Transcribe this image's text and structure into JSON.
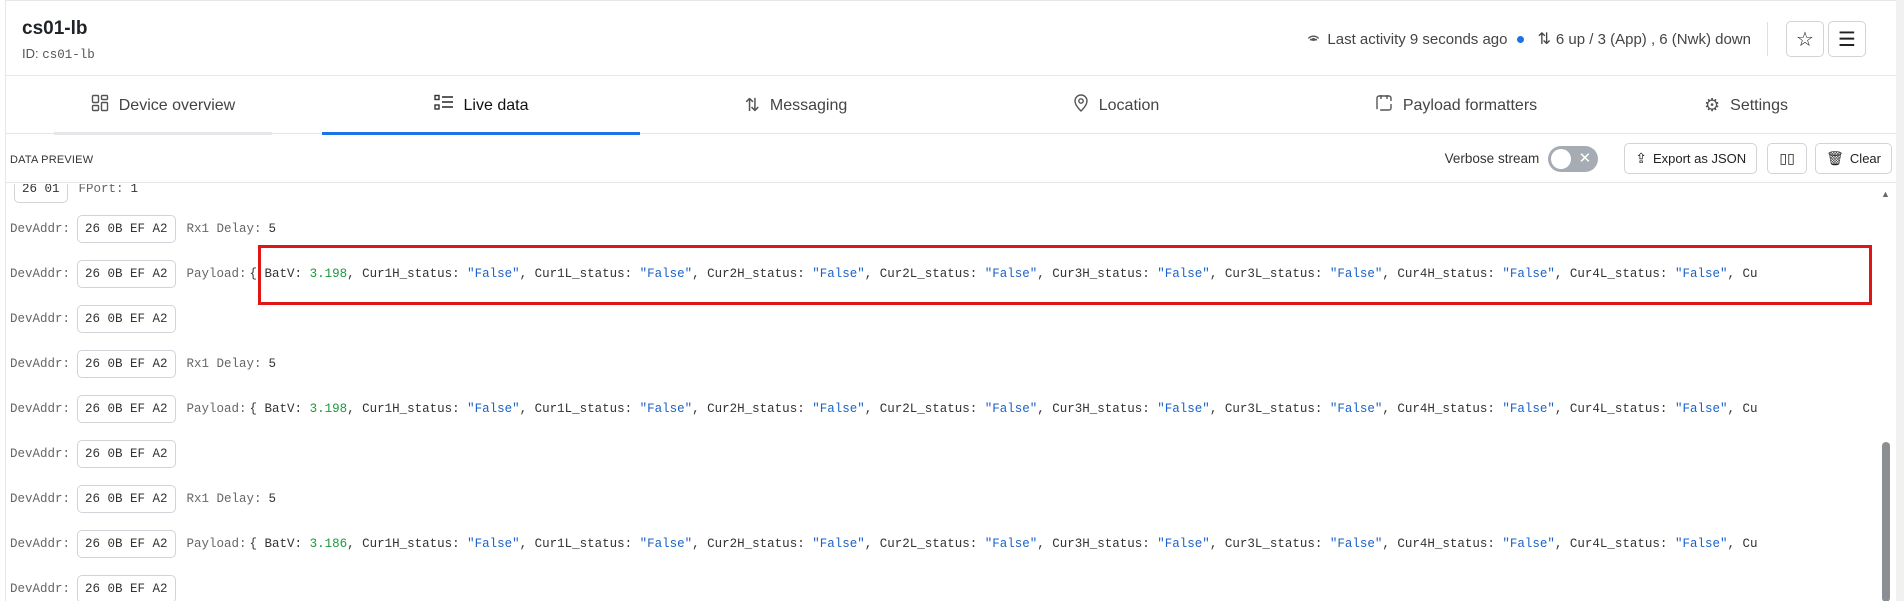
{
  "device": {
    "title": "cs01-lb",
    "id_label": "ID:",
    "id_value": "cs01-lb"
  },
  "header": {
    "last_activity": "Last activity 9 seconds ago",
    "updown": "6 up / 3 (App) , 6 (Nwk) down",
    "favorite_icon": "star-icon",
    "menu_icon": "hamburger-icon"
  },
  "tabs": [
    {
      "label": "Device overview",
      "icon": "grid-icon"
    },
    {
      "label": "Live data",
      "icon": "list-icon"
    },
    {
      "label": "Messaging",
      "icon": "arrows-updown-icon"
    },
    {
      "label": "Location",
      "icon": "pin-icon"
    },
    {
      "label": "Payload formatters",
      "icon": "formatter-icon"
    },
    {
      "label": "Settings",
      "icon": "gear-icon"
    }
  ],
  "toolbar": {
    "title": "DATA PREVIEW",
    "verbose_label": "Verbose stream",
    "export_label": "Export as JSON",
    "clear_label": "Clear"
  },
  "stream": {
    "top_partial": {
      "chip": "26 01",
      "key": "FPort:",
      "value": "1"
    },
    "devaddr_key": "DevAddr:",
    "devaddr_value": "26 0B EF A2",
    "rx1_key": "Rx1 Delay:",
    "rx1_value": "5",
    "payload_key": "Payload:",
    "payloads": [
      {
        "BatV": "3.198",
        "text_a": "{ BatV: ",
        "text_b": ", Cur1H_status: ",
        "f1": "\"False\"",
        "text_c": ", Cur1L_status: ",
        "f2": "\"False\"",
        "text_d": ", Cur2H_status: ",
        "f3": "\"False\"",
        "text_e": ", Cur2L_status: ",
        "f4": "\"False\"",
        "text_f": ", Cur3H_status: ",
        "f5": "\"False\"",
        "text_g": ", Cur3L_status: ",
        "f6": "\"False\"",
        "text_h": ", Cur4H_status: ",
        "f7": "\"False\"",
        "text_i": ", Cur4L_status: ",
        "f8": "\"False\"",
        "text_j": ", Cu"
      },
      {
        "BatV": "3.198",
        "text_a": "{ BatV: ",
        "text_b": ", Cur1H_status: ",
        "f1": "\"False\"",
        "text_c": ", Cur1L_status: ",
        "f2": "\"False\"",
        "text_d": ", Cur2H_status: ",
        "f3": "\"False\"",
        "text_e": ", Cur2L_status: ",
        "f4": "\"False\"",
        "text_f": ", Cur3H_status: ",
        "f5": "\"False\"",
        "text_g": ", Cur3L_status: ",
        "f6": "\"False\"",
        "text_h": ", Cur4H_status: ",
        "f7": "\"False\"",
        "text_i": ", Cur4L_status: ",
        "f8": "\"False\"",
        "text_j": ", Cu"
      },
      {
        "BatV": "3.186",
        "text_a": "{ BatV: ",
        "text_b": ", Cur1H_status: ",
        "f1": "\"False\"",
        "text_c": ", Cur1L_status: ",
        "f2": "\"False\"",
        "text_d": ", Cur2H_status: ",
        "f3": "\"False\"",
        "text_e": ", Cur2L_status: ",
        "f4": "\"False\"",
        "text_f": ", Cur3H_status: ",
        "f5": "\"False\"",
        "text_g": ", Cur3L_status: ",
        "f6": "\"False\"",
        "text_h": ", Cur4H_status: ",
        "f7": "\"False\"",
        "text_i": ", Cur4L_status: ",
        "f8": "\"False\"",
        "text_j": ", Cu"
      }
    ]
  },
  "colors": {
    "accent": "#1a73e8",
    "highlight": "#e01515",
    "number": "#1a9a3b",
    "string": "#1a62c8"
  }
}
